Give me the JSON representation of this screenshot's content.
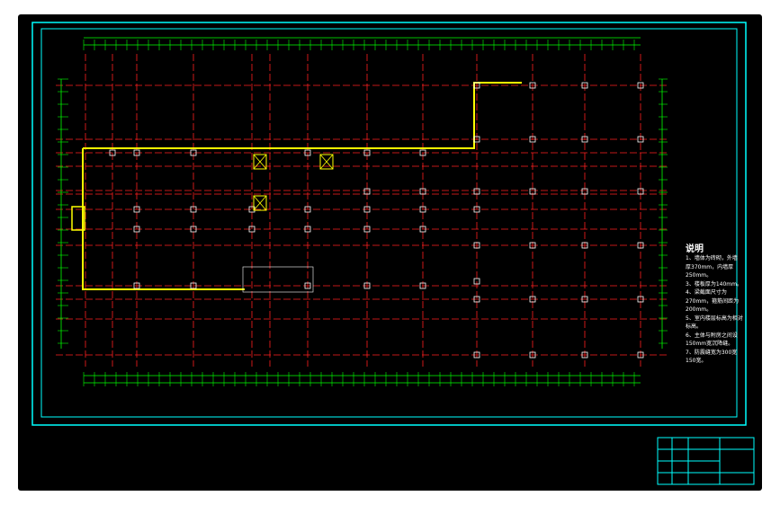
{
  "drawing": {
    "type": "floor-plan-cad",
    "background": "#000000",
    "frame_color": "#00ffff",
    "axis_color": "#ff2020",
    "column_color": "#ffffff",
    "wall_color": "#ffff00",
    "dimension_color": "#00ff00"
  },
  "notes": {
    "title": "说明",
    "lines": [
      "1、墙体为砖砌，外墙",
      "厚370mm，内墙厚",
      "250mm。",
      "3、楼板厚为140mm。",
      "4、梁截面尺寸为",
      "270mm，箍筋间距为",
      "200mm。",
      "5、室内楼层标高为相对",
      "标高。",
      "6、主体与附房之间设",
      "150mm宽沉降缝。",
      "7、防震缝宽为300宽",
      "150宽。"
    ]
  },
  "title_block": {
    "rows": 4,
    "cols": 3
  }
}
